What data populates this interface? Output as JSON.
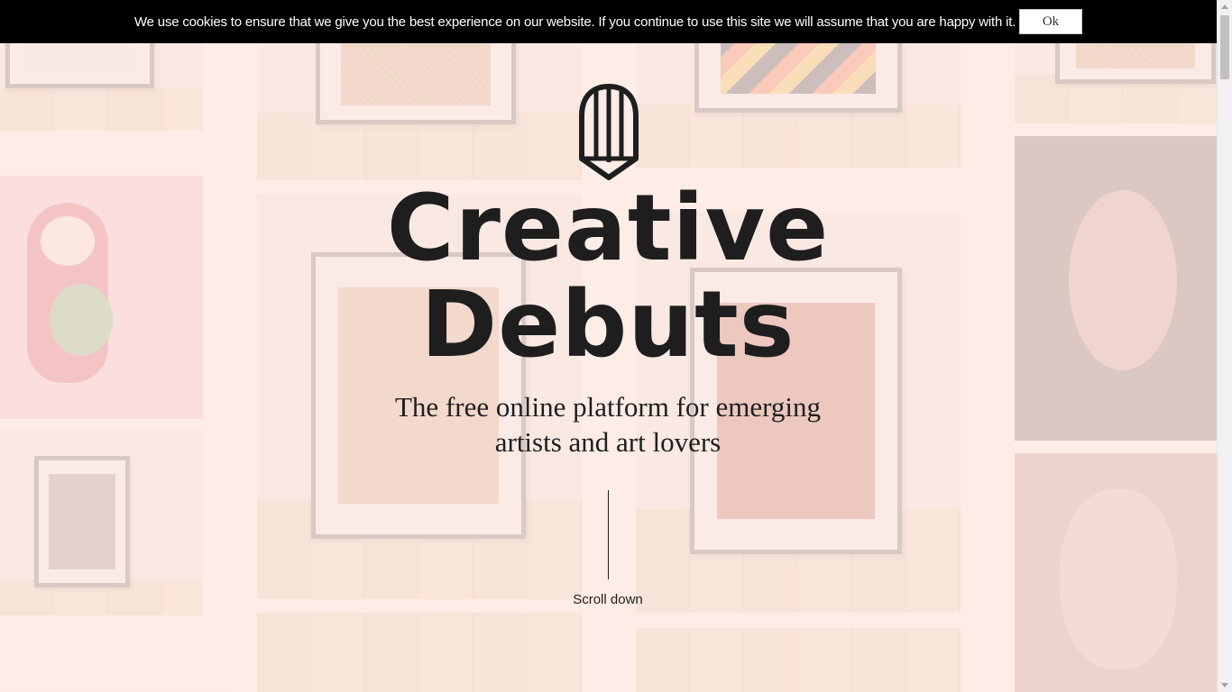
{
  "cookie_banner": {
    "message": "We use cookies to ensure that we give you the best experience on our website. If you continue to use this site we will assume that you are happy with it.",
    "ok_label": "Ok"
  },
  "hero": {
    "logo_icon": "pencil-logo-icon",
    "title_line1": "Creative",
    "title_line2": "Debuts",
    "tagline_line1": "The free online platform for emerging",
    "tagline_line2": "artists and art lovers",
    "scroll_label": "Scroll down"
  },
  "colors": {
    "background": "#fde9e4",
    "text": "#1e1e1e",
    "cookie_bar": "#000000"
  }
}
